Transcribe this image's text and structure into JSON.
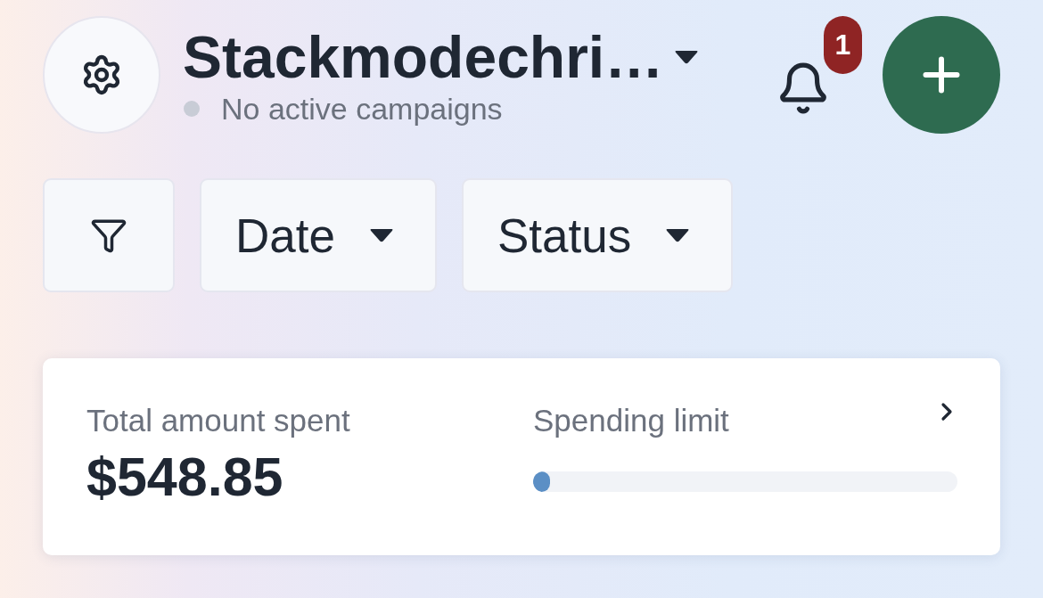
{
  "header": {
    "title": "Stackmodechri…",
    "status": {
      "active": false,
      "text": "No active campaigns"
    },
    "notifications": {
      "badge": "1"
    }
  },
  "filters": [
    {
      "label": "Date"
    },
    {
      "label": "Status"
    }
  ],
  "summary": {
    "total": {
      "label": "Total amount spent",
      "value": "$548.85"
    },
    "spending_limit": {
      "label": "Spending limit",
      "level": 0.04
    }
  }
}
